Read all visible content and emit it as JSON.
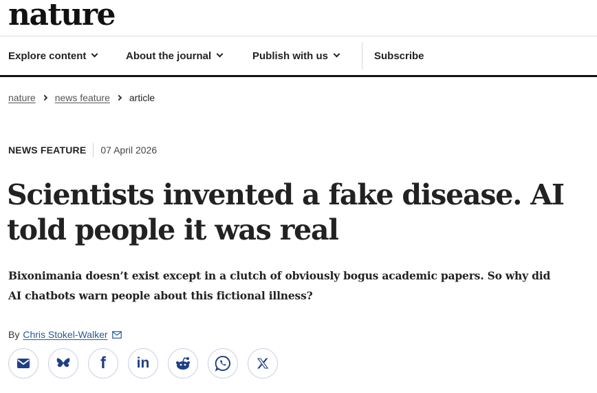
{
  "header": {
    "logo": "nature"
  },
  "nav": {
    "items": [
      {
        "label": "Explore content",
        "has_dropdown": true
      },
      {
        "label": "About the journal",
        "has_dropdown": true
      },
      {
        "label": "Publish with us",
        "has_dropdown": true
      },
      {
        "label": "Subscribe",
        "has_dropdown": false
      }
    ]
  },
  "breadcrumb": {
    "items": [
      "nature",
      "news feature",
      "article"
    ]
  },
  "article": {
    "type": "NEWS FEATURE",
    "date": "07 April 2026",
    "title": "Scientists invented a fake disease. AI told people it was real",
    "standfirst": "Bixonimania doesn’t exist except in a clutch of obviously bogus academic papers. So why did AI chatbots warn people about this fictional illness?",
    "byline_prefix": "By",
    "author": "Chris Stokel-Walker"
  },
  "share": {
    "icons": [
      "email-icon",
      "bluesky-icon",
      "facebook-icon",
      "linkedin-icon",
      "reddit-icon",
      "whatsapp-icon",
      "x-icon"
    ],
    "facebook_glyph": "f",
    "linkedin_glyph": "in"
  },
  "colors": {
    "icon_blue": "#1f3f86",
    "link_blue": "#25599b",
    "text": "#222222"
  }
}
